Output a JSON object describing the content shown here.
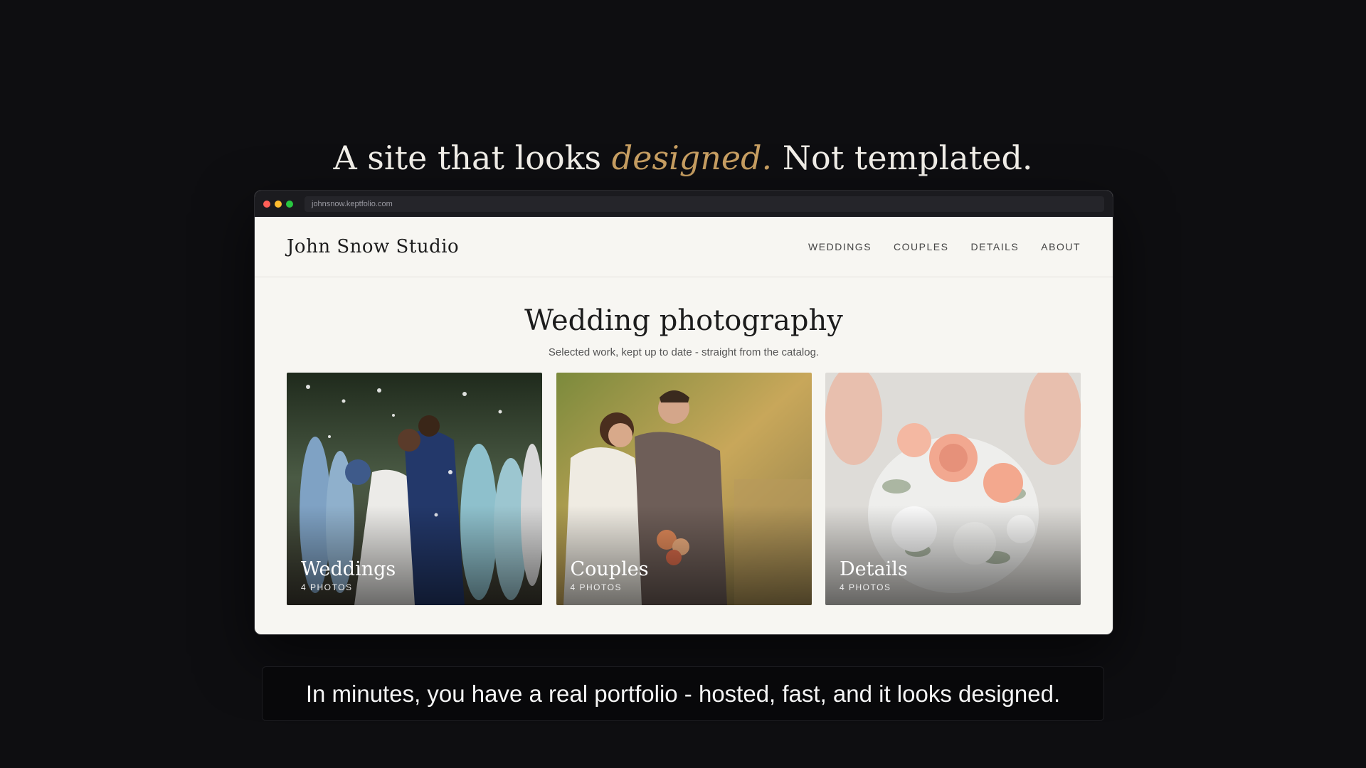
{
  "headline": {
    "before": "A site that looks ",
    "accent": "designed.",
    "after": " Not templated."
  },
  "browser": {
    "url": "johnsnow.keptfolio.com",
    "traffic_lights": [
      "#ff5f57",
      "#febc2e",
      "#28c840"
    ]
  },
  "site": {
    "title": "John Snow Studio",
    "nav": [
      "WEDDINGS",
      "COUPLES",
      "DETAILS",
      "ABOUT"
    ],
    "heading": "Wedding photography",
    "subheading": "Selected work, kept up to date - straight from the catalog.",
    "cards": [
      {
        "title": "Weddings",
        "count": "4 PHOTOS"
      },
      {
        "title": "Couples",
        "count": "4 PHOTOS"
      },
      {
        "title": "Details",
        "count": "4 PHOTOS"
      }
    ]
  },
  "caption": "In minutes, you have a real portfolio - hosted, fast, and it looks designed.",
  "colors": {
    "background": "#0e0e11",
    "accent": "#c9a063",
    "site_background": "#f7f6f2"
  }
}
